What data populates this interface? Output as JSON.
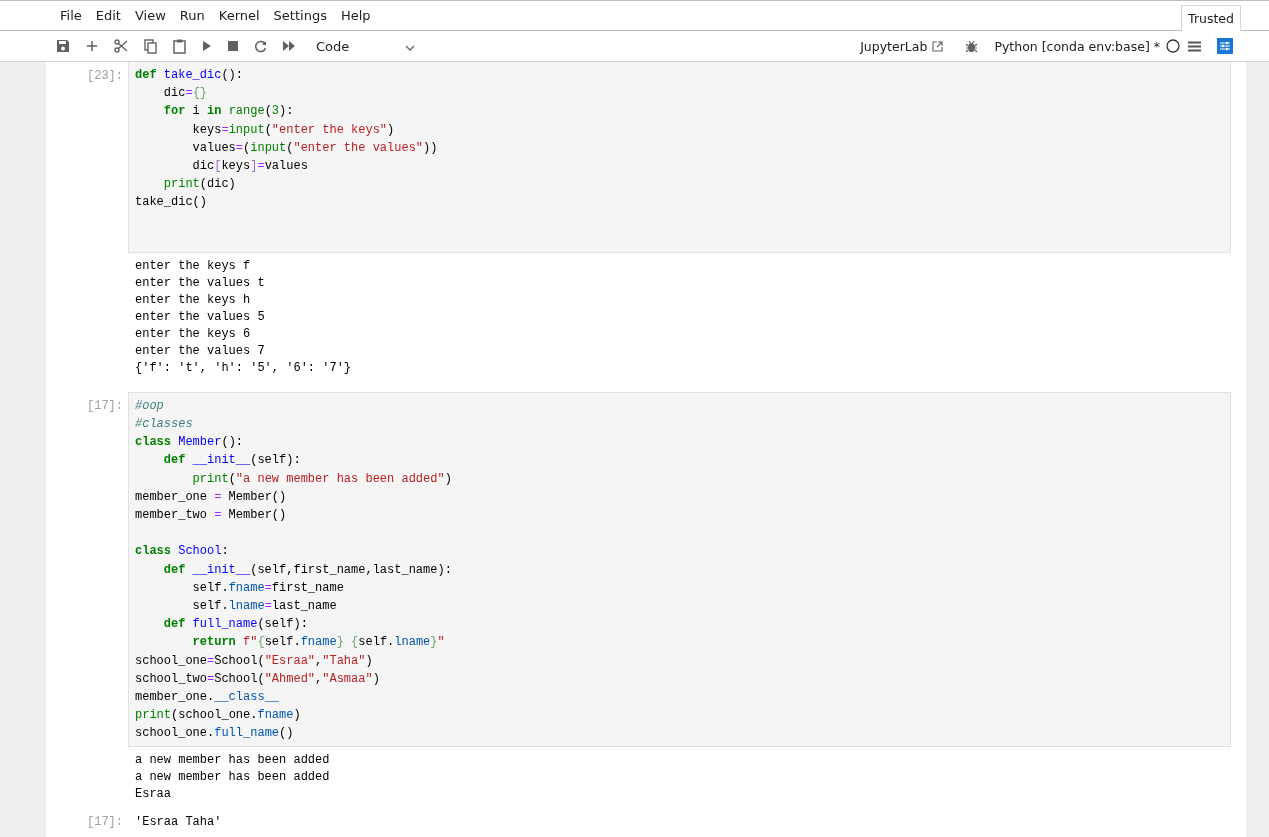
{
  "menu": [
    "File",
    "Edit",
    "View",
    "Run",
    "Kernel",
    "Settings",
    "Help"
  ],
  "trusted_tab": {
    "label": "Trusted"
  },
  "toolbar": {
    "cell_type": "Code",
    "open_in": "JupyterLab",
    "kernel": "Python [conda env:base] *"
  },
  "cells": [
    {
      "prompt": "[23]:",
      "input": [
        {
          "kind": "code",
          "tokens": [
            {
              "text": "def ",
              "kind": "kw"
            },
            {
              "text": "take_dic",
              "kind": "def"
            },
            {
              "text": "():",
              "kind": "plain"
            }
          ]
        },
        {
          "kind": "code",
          "tokens": [
            {
              "text": "    dic",
              "kind": "plain"
            },
            {
              "text": "=",
              "kind": "op"
            },
            {
              "text": "{}",
              "kind": "brace"
            }
          ]
        },
        {
          "kind": "code",
          "tokens": [
            {
              "text": "    for",
              "kind": "kw"
            },
            {
              "text": " i ",
              "kind": "plain"
            },
            {
              "text": "in ",
              "kind": "kw"
            },
            {
              "text": "range",
              "kind": "bi"
            },
            {
              "text": "(",
              "kind": "plain"
            },
            {
              "text": "3",
              "kind": "num"
            },
            {
              "text": "):",
              "kind": "plain"
            }
          ]
        },
        {
          "kind": "code",
          "tokens": [
            {
              "text": "        keys",
              "kind": "plain"
            },
            {
              "text": "=",
              "kind": "op"
            },
            {
              "text": "input",
              "kind": "bi"
            },
            {
              "text": "(",
              "kind": "plain"
            },
            {
              "text": "\"enter the keys\"",
              "kind": "str"
            },
            {
              "text": ")",
              "kind": "plain"
            }
          ]
        },
        {
          "kind": "code",
          "tokens": [
            {
              "text": "        values",
              "kind": "plain"
            },
            {
              "text": "=",
              "kind": "op"
            },
            {
              "text": "(",
              "kind": "plain"
            },
            {
              "text": "input",
              "kind": "bi"
            },
            {
              "text": "(",
              "kind": "plain"
            },
            {
              "text": "\"enter the values\"",
              "kind": "str"
            },
            {
              "text": "))",
              "kind": "plain"
            }
          ]
        },
        {
          "kind": "code",
          "tokens": [
            {
              "text": "        dic",
              "kind": "plain"
            },
            {
              "text": "[",
              "kind": "bracket"
            },
            {
              "text": "keys",
              "kind": "plain"
            },
            {
              "text": "]",
              "kind": "bracket"
            },
            {
              "text": "=",
              "kind": "op"
            },
            {
              "text": "values",
              "kind": "plain"
            }
          ]
        },
        {
          "kind": "code",
          "tokens": [
            {
              "text": "    print",
              "kind": "bi"
            },
            {
              "text": "(dic)",
              "kind": "plain"
            }
          ]
        },
        {
          "kind": "code",
          "tokens": [
            {
              "text": "take_dic()",
              "kind": "plain"
            }
          ]
        },
        {
          "kind": "blank"
        },
        {
          "kind": "blank"
        }
      ],
      "output": [
        "enter the keys f",
        "enter the values t",
        "enter the keys h",
        "enter the values 5",
        "enter the keys 6",
        "enter the values 7",
        "{'f': 't', 'h': '5', '6': '7'}"
      ]
    },
    {
      "prompt": "[17]:",
      "input": [
        {
          "kind": "code",
          "tokens": [
            {
              "text": "#oop",
              "kind": "com"
            }
          ]
        },
        {
          "kind": "code",
          "tokens": [
            {
              "text": "#classes",
              "kind": "com"
            }
          ]
        },
        {
          "kind": "code",
          "tokens": [
            {
              "text": "class ",
              "kind": "kw"
            },
            {
              "text": "Member",
              "kind": "def"
            },
            {
              "text": "():",
              "kind": "plain"
            }
          ]
        },
        {
          "kind": "code",
          "tokens": [
            {
              "text": "    def ",
              "kind": "kw"
            },
            {
              "text": "__init__",
              "kind": "def"
            },
            {
              "text": "(self):",
              "kind": "plain"
            }
          ]
        },
        {
          "kind": "code",
          "tokens": [
            {
              "text": "        print",
              "kind": "bi"
            },
            {
              "text": "(",
              "kind": "plain"
            },
            {
              "text": "\"a new member has been added\"",
              "kind": "str"
            },
            {
              "text": ")",
              "kind": "plain"
            }
          ]
        },
        {
          "kind": "code",
          "tokens": [
            {
              "text": "member_one ",
              "kind": "plain"
            },
            {
              "text": "=",
              "kind": "op"
            },
            {
              "text": " Member()",
              "kind": "plain"
            }
          ]
        },
        {
          "kind": "code",
          "tokens": [
            {
              "text": "member_two ",
              "kind": "plain"
            },
            {
              "text": "=",
              "kind": "op"
            },
            {
              "text": " Member()",
              "kind": "plain"
            }
          ]
        },
        {
          "kind": "blank"
        },
        {
          "kind": "code",
          "tokens": [
            {
              "text": "class ",
              "kind": "kw"
            },
            {
              "text": "School",
              "kind": "def"
            },
            {
              "text": ":",
              "kind": "plain"
            }
          ]
        },
        {
          "kind": "code",
          "tokens": [
            {
              "text": "    def ",
              "kind": "kw"
            },
            {
              "text": "__init__",
              "kind": "def"
            },
            {
              "text": "(self,first_name,last_name):",
              "kind": "plain"
            }
          ]
        },
        {
          "kind": "code",
          "tokens": [
            {
              "text": "        self.",
              "kind": "plain"
            },
            {
              "text": "fname",
              "kind": "attr"
            },
            {
              "text": "=",
              "kind": "op"
            },
            {
              "text": "first_name",
              "kind": "plain"
            }
          ]
        },
        {
          "kind": "code",
          "tokens": [
            {
              "text": "        self.",
              "kind": "plain"
            },
            {
              "text": "lname",
              "kind": "attr"
            },
            {
              "text": "=",
              "kind": "op"
            },
            {
              "text": "last_name",
              "kind": "plain"
            }
          ]
        },
        {
          "kind": "code",
          "tokens": [
            {
              "text": "    def ",
              "kind": "kw"
            },
            {
              "text": "full_name",
              "kind": "def"
            },
            {
              "text": "(self):",
              "kind": "plain"
            }
          ]
        },
        {
          "kind": "code",
          "tokens": [
            {
              "text": "        return ",
              "kind": "kw"
            },
            {
              "text": "f\"",
              "kind": "str"
            },
            {
              "text": "{",
              "kind": "brace"
            },
            {
              "text": "self.",
              "kind": "plain"
            },
            {
              "text": "fname",
              "kind": "attr"
            },
            {
              "text": "} {",
              "kind": "brace"
            },
            {
              "text": "self.",
              "kind": "plain"
            },
            {
              "text": "lname",
              "kind": "attr"
            },
            {
              "text": "}",
              "kind": "brace"
            },
            {
              "text": "\"",
              "kind": "str"
            }
          ]
        },
        {
          "kind": "code",
          "tokens": [
            {
              "text": "school_one",
              "kind": "plain"
            },
            {
              "text": "=",
              "kind": "op"
            },
            {
              "text": "School(",
              "kind": "plain"
            },
            {
              "text": "\"Esraa\"",
              "kind": "str"
            },
            {
              "text": ",",
              "kind": "plain"
            },
            {
              "text": "\"Taha\"",
              "kind": "str"
            },
            {
              "text": ")",
              "kind": "plain"
            }
          ]
        },
        {
          "kind": "code",
          "tokens": [
            {
              "text": "school_two",
              "kind": "plain"
            },
            {
              "text": "=",
              "kind": "op"
            },
            {
              "text": "School(",
              "kind": "plain"
            },
            {
              "text": "\"Ahmed\"",
              "kind": "str"
            },
            {
              "text": ",",
              "kind": "plain"
            },
            {
              "text": "\"Asmaa\"",
              "kind": "str"
            },
            {
              "text": ")",
              "kind": "plain"
            }
          ]
        },
        {
          "kind": "code",
          "tokens": [
            {
              "text": "member_one.",
              "kind": "plain"
            },
            {
              "text": "__class__",
              "kind": "attr"
            }
          ]
        },
        {
          "kind": "code",
          "tokens": [
            {
              "text": "print",
              "kind": "bi"
            },
            {
              "text": "(school_one.",
              "kind": "plain"
            },
            {
              "text": "fname",
              "kind": "attr"
            },
            {
              "text": ")",
              "kind": "plain"
            }
          ]
        },
        {
          "kind": "code",
          "tokens": [
            {
              "text": "school_one.",
              "kind": "plain"
            },
            {
              "text": "full_name",
              "kind": "attr"
            },
            {
              "text": "()",
              "kind": "plain"
            }
          ]
        }
      ],
      "output": [
        "a new member has been added",
        "a new member has been added",
        "Esraa"
      ],
      "result": {
        "prompt": "[17]:",
        "text": "'Esraa Taha'"
      }
    }
  ]
}
